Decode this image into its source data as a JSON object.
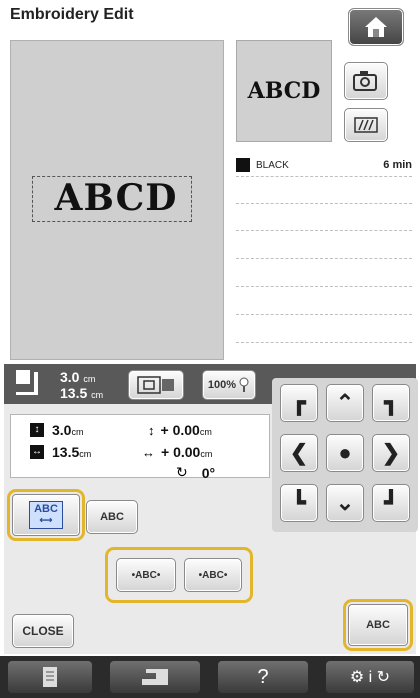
{
  "header": {
    "title": "Embroidery Edit"
  },
  "preview": {
    "text": "ABCD"
  },
  "canvas": {
    "text": "ABCD"
  },
  "thread": {
    "color": "BLACK",
    "time": "6 min"
  },
  "size": {
    "height": "3.0",
    "width": "13.5",
    "unit": "cm"
  },
  "zoom": {
    "label": "100%"
  },
  "values": {
    "height": "3.0",
    "width": "13.5",
    "unit": "cm",
    "offset_v": "+ 0.00",
    "offset_h": "+ 0.00",
    "angle": "0°"
  },
  "buttons": {
    "abc_label": "ABC",
    "abc_left": "ABC",
    "abc_spacing_1": "•ABC•",
    "abc_spacing_2": "•ABC•",
    "abc_right": "ABC",
    "close": "CLOSE",
    "help": "?"
  },
  "colors": {
    "highlight": "#e3b52a",
    "bar": "#595959",
    "bottom": "#2b2b2b"
  }
}
